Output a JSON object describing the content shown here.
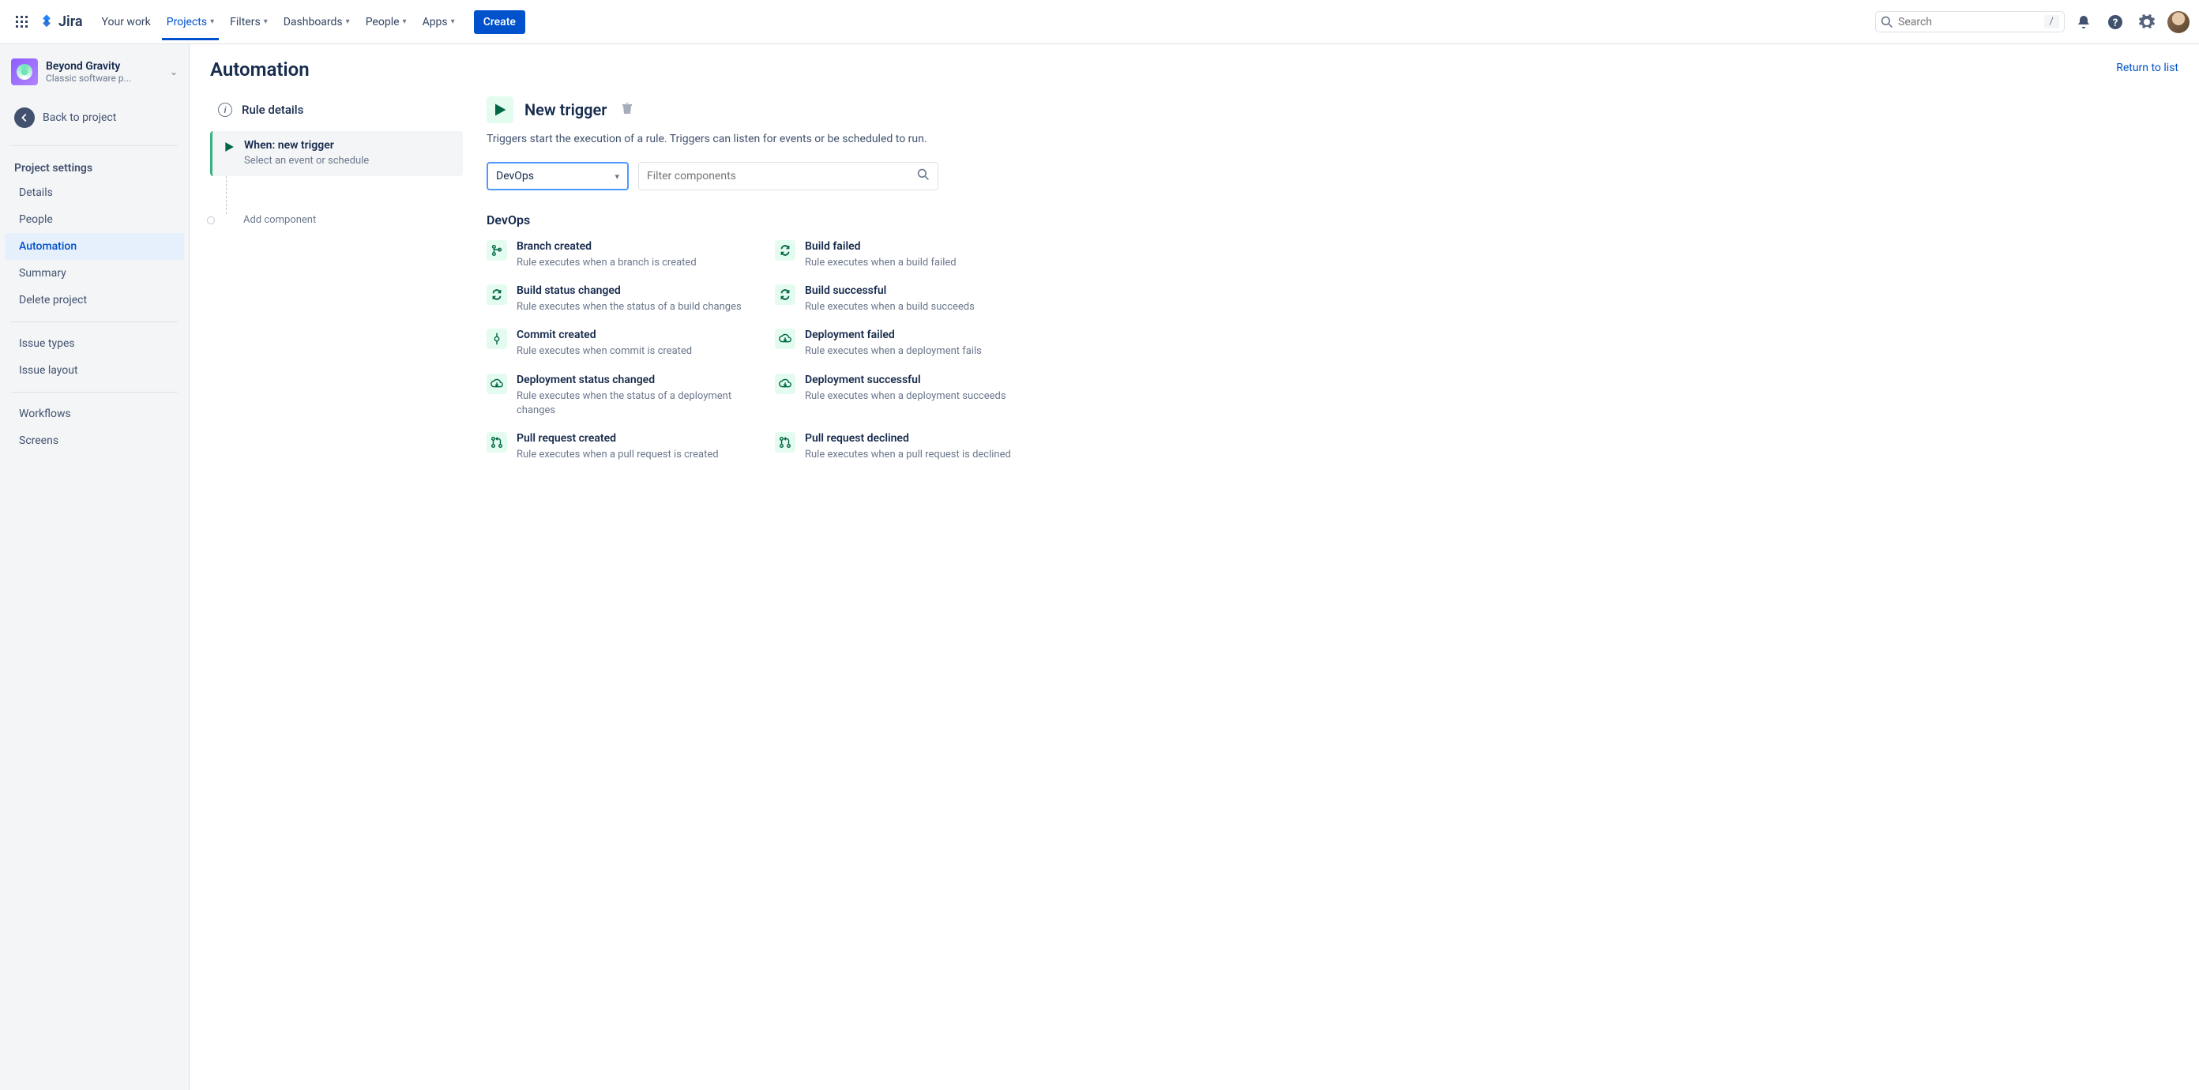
{
  "topnav": {
    "product": "Jira",
    "items": [
      "Your work",
      "Projects",
      "Filters",
      "Dashboards",
      "People",
      "Apps"
    ],
    "active_index": 1,
    "create": "Create",
    "search_placeholder": "Search",
    "search_shortcut": "/"
  },
  "sidebar": {
    "project_name": "Beyond Gravity",
    "project_type": "Classic software p...",
    "back": "Back to project",
    "heading": "Project settings",
    "links": [
      "Details",
      "People",
      "Automation",
      "Summary",
      "Delete project"
    ],
    "active_index": 2,
    "links2": [
      "Issue types",
      "Issue layout"
    ],
    "links3": [
      "Workflows",
      "Screens"
    ]
  },
  "main": {
    "title": "Automation",
    "return": "Return to list",
    "rule_details": "Rule details",
    "rule_card_title": "When: new trigger",
    "rule_card_sub": "Select an event or schedule",
    "add_component": "Add component",
    "trigger_title": "New trigger",
    "trigger_desc": "Triggers start the execution of a rule. Triggers can listen for events or be scheduled to run.",
    "select_value": "DevOps",
    "filter_placeholder": "Filter components",
    "category": "DevOps",
    "triggers": [
      {
        "icon": "branch",
        "title": "Branch created",
        "desc": "Rule executes when a branch is created"
      },
      {
        "icon": "cycle",
        "title": "Build failed",
        "desc": "Rule executes when a build failed"
      },
      {
        "icon": "cycle",
        "title": "Build status changed",
        "desc": "Rule executes when the status of a build changes"
      },
      {
        "icon": "cycle",
        "title": "Build successful",
        "desc": "Rule executes when a build succeeds"
      },
      {
        "icon": "commit",
        "title": "Commit created",
        "desc": "Rule executes when commit is created"
      },
      {
        "icon": "cloud",
        "title": "Deployment failed",
        "desc": "Rule executes when a deployment fails"
      },
      {
        "icon": "cloud",
        "title": "Deployment status changed",
        "desc": "Rule executes when the status of a deployment changes"
      },
      {
        "icon": "cloud",
        "title": "Deployment successful",
        "desc": "Rule executes when a deployment succeeds"
      },
      {
        "icon": "pr",
        "title": "Pull request created",
        "desc": "Rule executes when a pull request is created"
      },
      {
        "icon": "pr",
        "title": "Pull request declined",
        "desc": "Rule executes when a pull request is declined"
      }
    ]
  }
}
